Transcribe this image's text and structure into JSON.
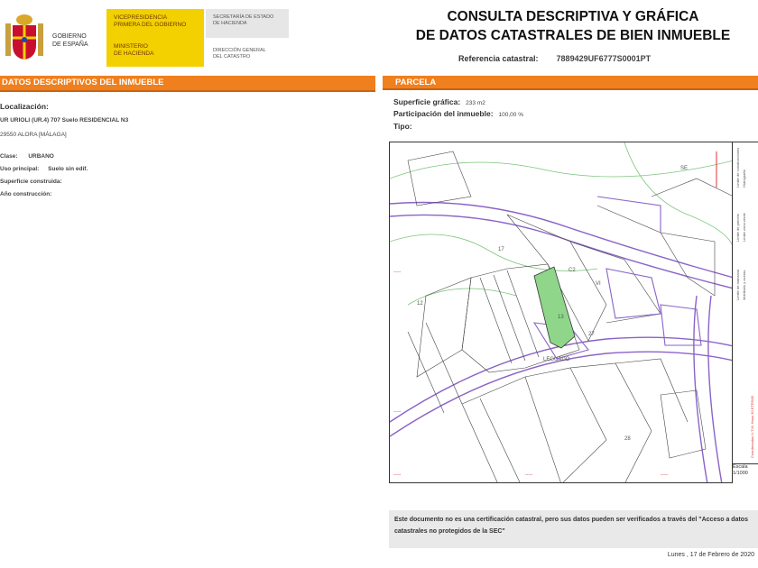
{
  "header": {
    "gov_lines": [
      "GOBIERNO",
      "DE ESPAÑA"
    ],
    "yellow_lines_1": [
      "VICEPRESIDENCIA",
      "PRIMERA DEL GOBIERNO"
    ],
    "yellow_lines_2": [
      "MINISTERIO",
      "DE HACIENDA"
    ],
    "grey_lines": [
      "SECRETARÍA DE ESTADO",
      "DE HACIENDA"
    ],
    "dg_lines": [
      "DIRECCIÓN GENERAL",
      "DEL CATASTRO"
    ],
    "title_line1": "CONSULTA DESCRIPTIVA Y GRÁFICA",
    "title_line2": "DE DATOS CATASTRALES DE BIEN INMUEBLE",
    "ref_label": "Referencia catastral:",
    "ref_value": "7889429UF6777S0001PT"
  },
  "left": {
    "bar": "DATOS DESCRIPTIVOS DEL INMUEBLE",
    "loc_label": "Localización:",
    "loc_line1": "UR URIOLI (UR.4) 707 Suelo RESIDENCIAL N3",
    "loc_line2": "29550 ALORA [MÁLAGA]",
    "clase_label": "Clase:",
    "clase_value": "URBANO",
    "uso_label": "Uso principal:",
    "uso_value": "Suelo sin edif.",
    "sup_label": "Superficie construida:",
    "anio_label": "Año construcción:"
  },
  "right": {
    "bar": "PARCELA",
    "sup_label": "Superficie gráfica:",
    "sup_value": "233 m2",
    "part_label": "Participación del inmueble:",
    "part_value": "100,00 %",
    "tipo_label": "Tipo:"
  },
  "map": {
    "labels": [
      "SE",
      "C2",
      "13",
      "12",
      "VI",
      "27",
      "17",
      "28",
      "LEGUADO"
    ]
  },
  "legend": {
    "lines": [
      "Límite de manzana",
      "Límite de parcela",
      "Límite de construcciones",
      "Mobiliario y aceras",
      "Límite zona verde",
      "Hidrografía"
    ],
    "coords": "Coordenadas U.T.M. Huso 30 ETRS89",
    "scale": "Escala 1/1000"
  },
  "note": "Este documento no es una certificación catastral, pero sus datos pueden ser verificados a través del \"Acceso a datos catastrales no protegidos de la SEC\"",
  "date": "Lunes , 17 de Febrero de 2020",
  "colors": {
    "orange": "#f07f1d",
    "yellow": "#f3d000",
    "parcel_green": "#8fd68a",
    "boundary": "#8a63c8"
  }
}
